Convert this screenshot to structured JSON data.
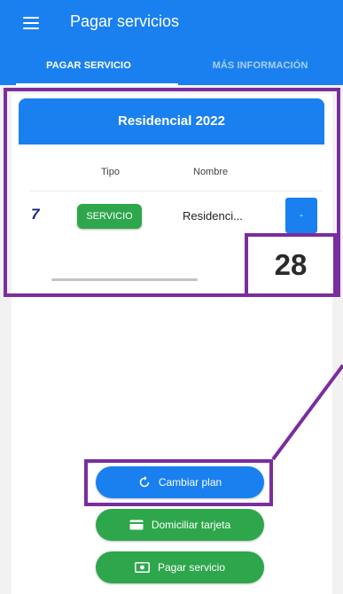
{
  "app": {
    "title": "Pagar servicios"
  },
  "tabs": [
    {
      "label": "PAGAR SERVICIO",
      "active": true
    },
    {
      "label": "MÁS INFORMACIÓN",
      "active": false
    }
  ],
  "card": {
    "title": "Residencial 2022",
    "columns": [
      "Tipo",
      "Nombre"
    ],
    "rows": [
      {
        "logo": "7",
        "type": "SERVICIO",
        "name": "Residenci...",
        "action": "-"
      }
    ]
  },
  "annotation": {
    "label": "28"
  },
  "buttons": {
    "change_plan": "Cambiar plan",
    "direct_debit": "Domiciliar tarjeta",
    "pay_service": "Pagar servicio"
  },
  "icons": {
    "menu": "menu-icon",
    "change_plan": "refresh-icon",
    "direct_debit": "credit-card-icon",
    "pay_service": "cash-icon"
  },
  "colors": {
    "primary": "#1a80f0",
    "success": "#2ea64b",
    "annotation": "#7a2d9e"
  }
}
